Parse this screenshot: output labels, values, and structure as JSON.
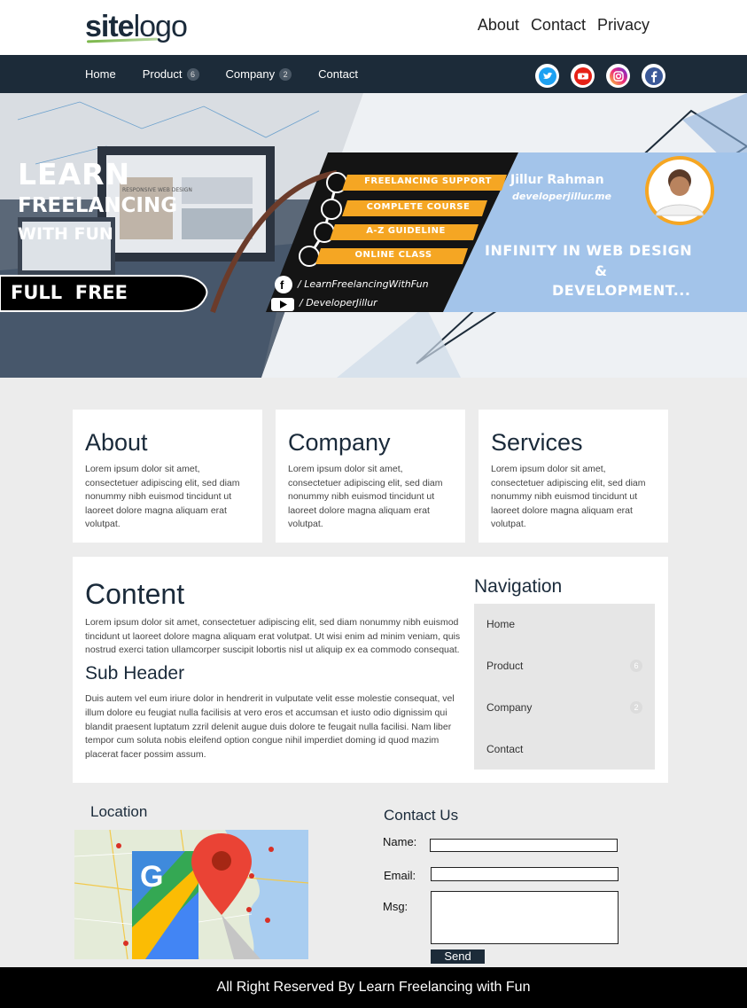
{
  "header": {
    "logo_bold": "site",
    "logo_light": "logo",
    "links": [
      "About",
      "Contact",
      "Privacy"
    ]
  },
  "navbar": {
    "items": [
      {
        "label": "Home",
        "badge": ""
      },
      {
        "label": "Product",
        "badge": "6"
      },
      {
        "label": "Company",
        "badge": "2"
      },
      {
        "label": "Contact",
        "badge": ""
      }
    ],
    "social": [
      "twitter-icon",
      "youtube-icon",
      "instagram-icon",
      "facebook-icon"
    ]
  },
  "hero": {
    "line1": "LEARN",
    "line2": "FREELANCING",
    "line3": "WITH FUN",
    "badge": "FULL  FREE",
    "screen_text": "RESPONSIVE WEB DESIGN",
    "steps": [
      "FREELANCING SUPPORT",
      "COMPLETE COURSE",
      "A-Z GUIDELINE",
      "ONLINE CLASS"
    ],
    "facebook": "/ LearnFreelancingWithFun",
    "youtube": "/ DeveloperJillur",
    "name": "Jillur Rahman",
    "site": "developerjillur.me",
    "tagline1": "INFINITY IN WEB DESIGN",
    "tagline_amp": "&",
    "tagline2": "DEVELOPMENT..."
  },
  "cards": [
    {
      "title": "About",
      "text": "Lorem ipsum dolor sit amet, consectetuer adipiscing elit, sed diam nonummy nibh euismod tincidunt ut laoreet dolore magna aliquam erat volutpat."
    },
    {
      "title": "Company",
      "text": "Lorem ipsum dolor sit amet, consectetuer adipiscing elit, sed diam nonummy nibh euismod tincidunt ut laoreet dolore magna aliquam erat volutpat."
    },
    {
      "title": "Services",
      "text": "Lorem ipsum dolor sit amet, consectetuer adipiscing elit, sed diam nonummy nibh euismod tincidunt ut laoreet dolore magna aliquam erat volutpat."
    }
  ],
  "content": {
    "title": "Content",
    "para1": "Lorem ipsum dolor sit amet, consectetuer adipiscing elit, sed diam nonummy nibh euismod tincidunt ut laoreet dolore magna aliquam erat volutpat. Ut wisi enim ad minim veniam, quis nostrud exerci tation ullamcorper suscipit lobortis nisl ut aliquip ex ea commodo consequat.",
    "subheader": "Sub Header",
    "para2": "Duis autem vel eum iriure dolor in hendrerit in vulputate velit esse molestie consequat, vel illum dolore eu feugiat nulla facilisis at vero eros et accumsan et iusto odio dignissim qui blandit praesent luptatum zzril delenit augue duis dolore te feugait nulla facilisi. Nam liber tempor cum soluta nobis eleifend option congue nihil imperdiet doming id quod mazim placerat facer possim assum."
  },
  "sidenav": {
    "title": "Navigation",
    "items": [
      {
        "label": "Home",
        "badge": ""
      },
      {
        "label": "Product",
        "badge": "6"
      },
      {
        "label": "Company",
        "badge": "2"
      },
      {
        "label": "Contact",
        "badge": ""
      }
    ]
  },
  "location": {
    "title": "Location"
  },
  "contact": {
    "title": "Contact Us",
    "name_label": "Name:",
    "email_label": "Email:",
    "msg_label": "Msg:",
    "send_label": "Send"
  },
  "footer": {
    "text": "All Right Reserved By Learn Freelancing with Fun"
  },
  "colors": {
    "navbar": "#1c2b39",
    "accent_yellow": "#f5a623",
    "banner_blue": "#a3c4ea"
  }
}
